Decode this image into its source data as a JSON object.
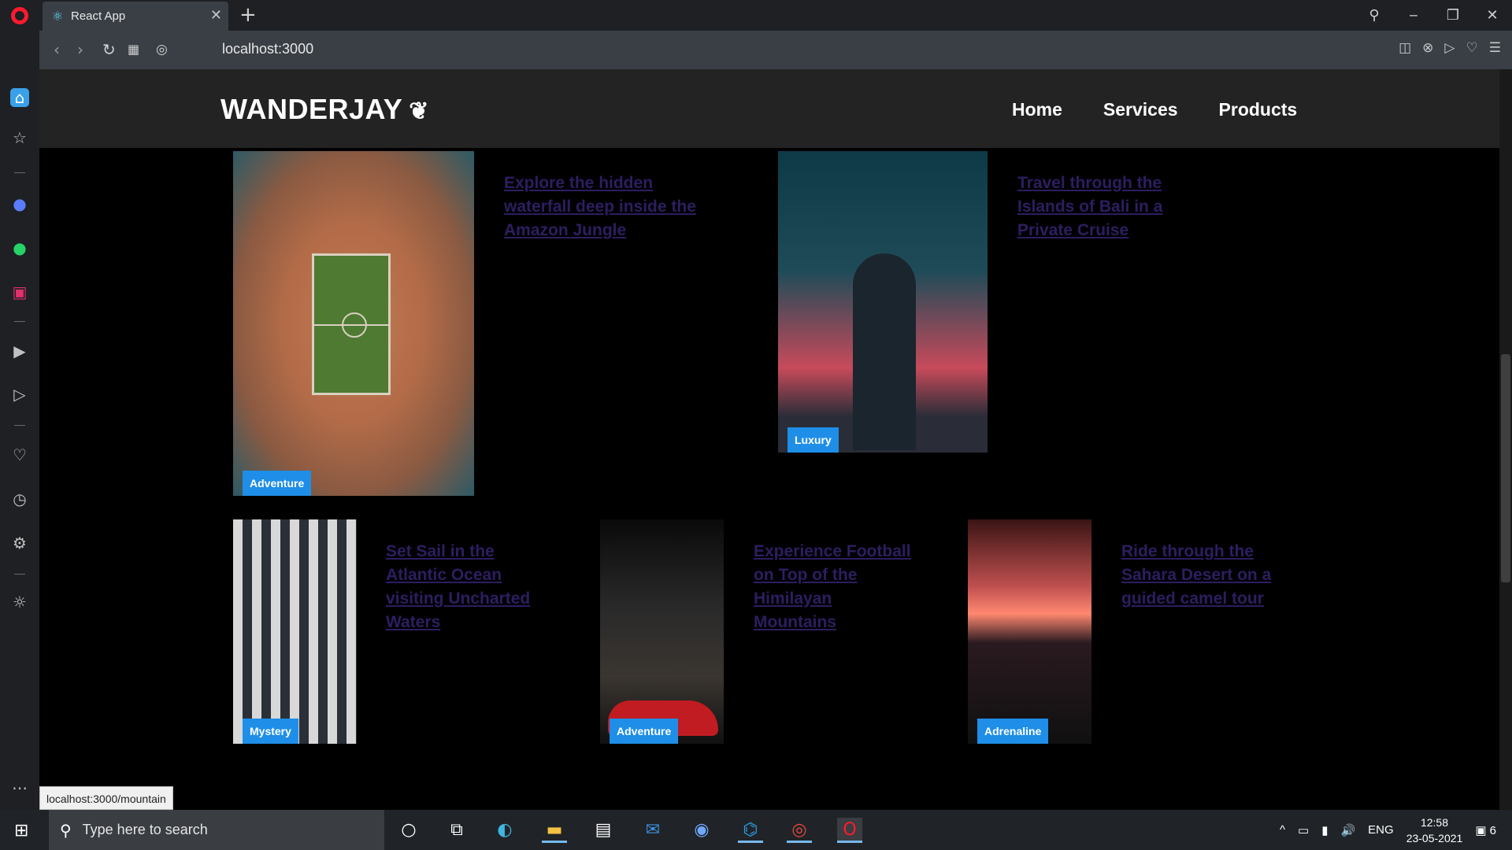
{
  "browser": {
    "tab_title": "React App",
    "url": "localhost:3000",
    "status_url": "localhost:3000/mountain"
  },
  "site": {
    "logo": "WANDERJAY",
    "nav": [
      "Home",
      "Services",
      "Products"
    ]
  },
  "cards": [
    {
      "title": "Explore the hidden waterfall deep inside the Amazon Jungle",
      "badge": "Adventure"
    },
    {
      "title": "Travel through the Islands of Bali in a Private Cruise",
      "badge": "Luxury"
    },
    {
      "title": "Set Sail in the Atlantic Ocean visiting Uncharted Waters",
      "badge": "Mystery"
    },
    {
      "title": "Experience Football on Top of the Himilayan Mountains",
      "badge": "Adventure"
    },
    {
      "title": "Ride through the Sahara Desert on a guided camel tour",
      "badge": "Adrenaline"
    }
  ],
  "taskbar": {
    "search_placeholder": "Type here to search",
    "lang": "ENG",
    "time": "12:58",
    "date": "23-05-2021",
    "notifications": "6"
  },
  "colors": {
    "badge": "#1e8ee8",
    "link": "#2d1e60",
    "nav_bg": "#232323"
  }
}
